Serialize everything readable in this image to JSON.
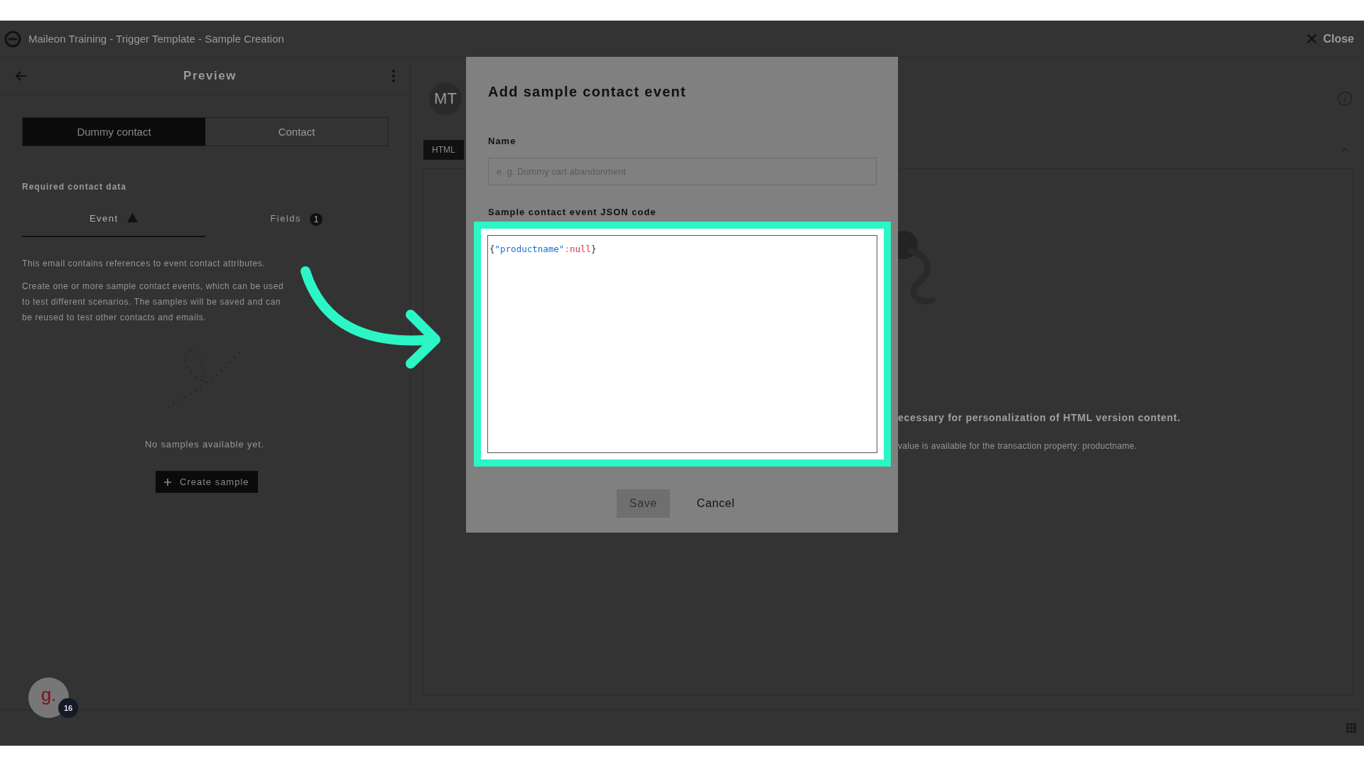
{
  "window": {
    "title": "Maileon Training - Trigger Template - Sample Creation",
    "close": "Close"
  },
  "preview": {
    "title": "Preview",
    "tabs": [
      {
        "label": "Dummy contact",
        "selected": true
      },
      {
        "label": "Contact",
        "selected": false
      }
    ],
    "section": "Required contact data",
    "subtabs": [
      {
        "label": "Event",
        "selected": true,
        "kind": "warning"
      },
      {
        "label": "Fields",
        "selected": false,
        "kind": "count",
        "badge": "1"
      }
    ],
    "intro": "This email contains references to event contact attributes.",
    "description": "Create one or more sample contact events, which can be used to test different scenarios. The samples will be saved and can be reused to test other contacts and emails.",
    "empty": "No samples available yet.",
    "create": "Create sample"
  },
  "content": {
    "avatar": "MT",
    "tab": "HTML",
    "notice": "ecessary for personalization of HTML version content.",
    "detail": "value is available for the transaction property: productname."
  },
  "dialog": {
    "title": "Add sample contact event",
    "name_label": "Name",
    "name_placeholder": "e. g. Dummy cart abandonment",
    "code_label": "Sample contact event JSON code",
    "code": [
      {
        "kind": "punct",
        "text": "{"
      },
      {
        "kind": "key",
        "text": "\"productname\""
      },
      {
        "kind": "colon",
        "text": ":"
      },
      {
        "kind": "null",
        "text": "null"
      },
      {
        "kind": "punct",
        "text": "}"
      }
    ],
    "buttons": [
      {
        "label": "Save",
        "kind": "primary"
      },
      {
        "label": "Cancel",
        "kind": "plain"
      }
    ]
  },
  "helper": {
    "logo": "g.",
    "count": "16"
  }
}
